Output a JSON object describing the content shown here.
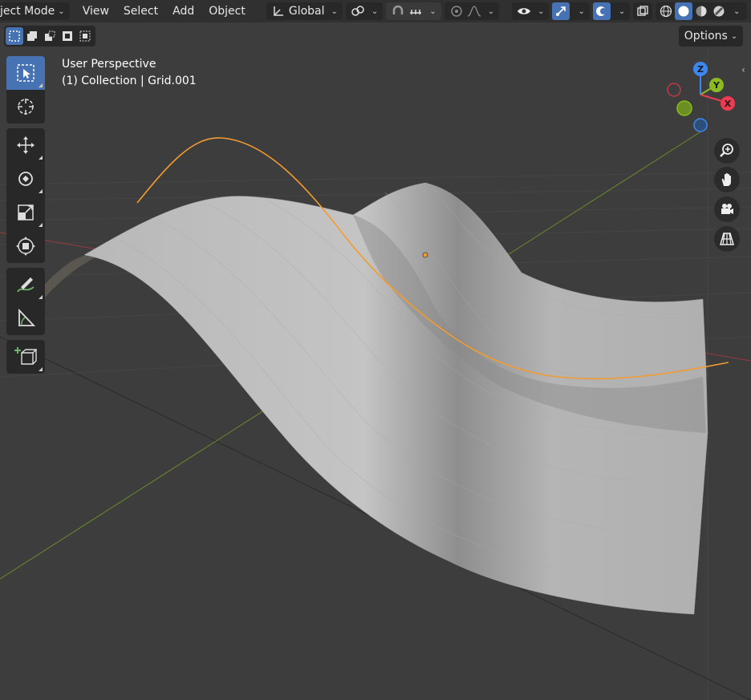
{
  "header": {
    "mode_label": "ject Mode",
    "menus": [
      "View",
      "Select",
      "Add",
      "Object"
    ],
    "transform_orientation": "Global"
  },
  "options_label": "Options",
  "overlay": {
    "view_name": "User Perspective",
    "object_info": "(1) Collection | Grid.001"
  },
  "gizmo": {
    "z_label": "Z",
    "y_label": "Y",
    "x_label": "X"
  },
  "colors": {
    "accent": "#4772b3",
    "x_axis": "#ee3b4f",
    "y_axis": "#8bba22",
    "z_axis": "#3f87f0",
    "curve": "#f39b30",
    "mesh": "#b8b8b8",
    "background": "#3d3d3d"
  },
  "icons": {
    "toolbar": [
      "select-box-icon",
      "cursor-icon",
      "move-icon",
      "rotate-icon",
      "scale-icon",
      "transform-icon",
      "annotate-icon",
      "measure-icon",
      "add-cube-icon"
    ],
    "nav": [
      "zoom-icon",
      "hand-icon",
      "camera-icon",
      "grid-icon"
    ]
  }
}
